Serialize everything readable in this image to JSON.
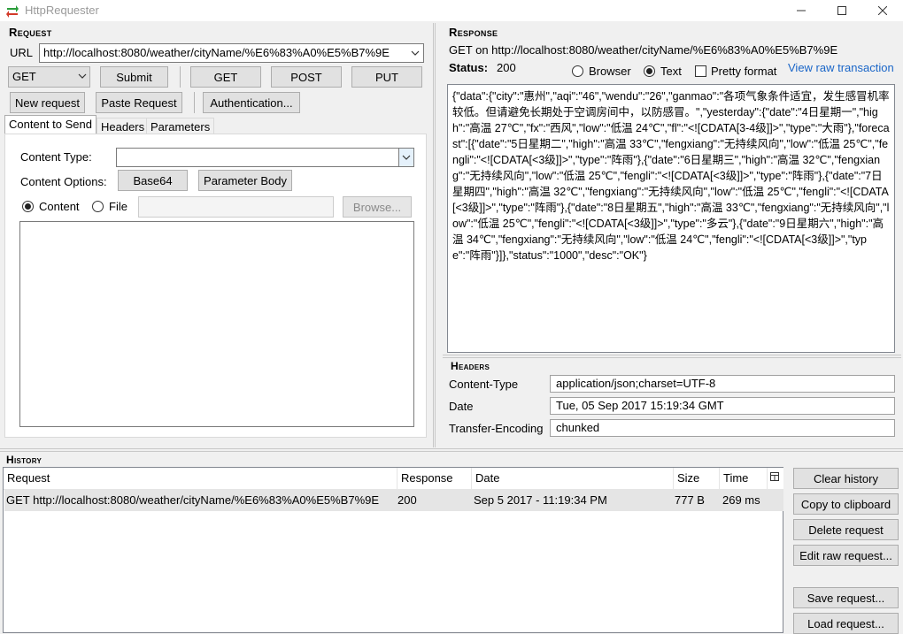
{
  "window": {
    "title": "HttpRequester"
  },
  "request": {
    "section_title": "Request",
    "url_label": "URL",
    "url_value": "http://localhost:8080/weather/cityName/%E6%83%A0%E5%B7%9E",
    "method": "GET",
    "submit_label": "Submit",
    "get_label": "GET",
    "post_label": "POST",
    "put_label": "PUT",
    "new_request_label": "New request",
    "paste_request_label": "Paste Request",
    "authentication_label": "Authentication...",
    "tabs": [
      "Content to Send",
      "Headers",
      "Parameters"
    ],
    "content_type_label": "Content Type:",
    "content_type_value": "",
    "content_options_label": "Content Options:",
    "base64_label": "Base64",
    "parameter_body_label": "Parameter Body",
    "content_radio_label": "Content",
    "file_radio_label": "File",
    "file_value": "",
    "browse_label": "Browse..."
  },
  "response": {
    "section_title": "Response",
    "summary": "GET on http://localhost:8080/weather/cityName/%E6%83%A0%E5%B7%9E",
    "status_label": "Status:",
    "status_value": "200",
    "browser_label": "Browser",
    "text_label": "Text",
    "pretty_format_label": "Pretty format",
    "view_raw_label": "View raw transaction",
    "selected_view": "Text",
    "pretty_format_checked": false,
    "body": "{\"data\":{\"city\":\"惠州\",\"aqi\":\"46\",\"wendu\":\"26\",\"ganmao\":\"各项气象条件适宜，发生感冒机率较低。但请避免长期处于空调房间中，以防感冒。\",\"yesterday\":{\"date\":\"4日星期一\",\"high\":\"高温 27℃\",\"fx\":\"西风\",\"low\":\"低温 24℃\",\"fl\":\"<![CDATA[3-4级]]>\",\"type\":\"大雨\"},\"forecast\":[{\"date\":\"5日星期二\",\"high\":\"高温 33℃\",\"fengxiang\":\"无持续风向\",\"low\":\"低温 25℃\",\"fengli\":\"<![CDATA[<3级]]>\",\"type\":\"阵雨\"},{\"date\":\"6日星期三\",\"high\":\"高温 32℃\",\"fengxiang\":\"无持续风向\",\"low\":\"低温 25℃\",\"fengli\":\"<![CDATA[<3级]]>\",\"type\":\"阵雨\"},{\"date\":\"7日星期四\",\"high\":\"高温 32℃\",\"fengxiang\":\"无持续风向\",\"low\":\"低温 25℃\",\"fengli\":\"<![CDATA[<3级]]>\",\"type\":\"阵雨\"},{\"date\":\"8日星期五\",\"high\":\"高温 33℃\",\"fengxiang\":\"无持续风向\",\"low\":\"低温 25℃\",\"fengli\":\"<![CDATA[<3级]]>\",\"type\":\"多云\"},{\"date\":\"9日星期六\",\"high\":\"高温 34℃\",\"fengxiang\":\"无持续风向\",\"low\":\"低温 24℃\",\"fengli\":\"<![CDATA[<3级]]>\",\"type\":\"阵雨\"}]},\"status\":\"1000\",\"desc\":\"OK\"}",
    "headers_title": "Headers",
    "headers": [
      {
        "name": "Content-Type",
        "value": "application/json;charset=UTF-8"
      },
      {
        "name": "Date",
        "value": "Tue, 05 Sep 2017 15:19:34 GMT"
      },
      {
        "name": "Transfer-Encoding",
        "value": "chunked"
      }
    ]
  },
  "history": {
    "section_title": "History",
    "columns": [
      "Request",
      "Response",
      "Date",
      "Size",
      "Time"
    ],
    "rows": [
      {
        "request": "GET http://localhost:8080/weather/cityName/%E6%83%A0%E5%B7%9E",
        "response": "200",
        "date": "Sep 5 2017 - 11:19:34 PM",
        "size": "777 B",
        "time": "269 ms"
      }
    ],
    "buttons": {
      "clear": "Clear history",
      "copy": "Copy to clipboard",
      "delete": "Delete request",
      "edit": "Edit raw request...",
      "save": "Save request...",
      "load": "Load request..."
    }
  }
}
